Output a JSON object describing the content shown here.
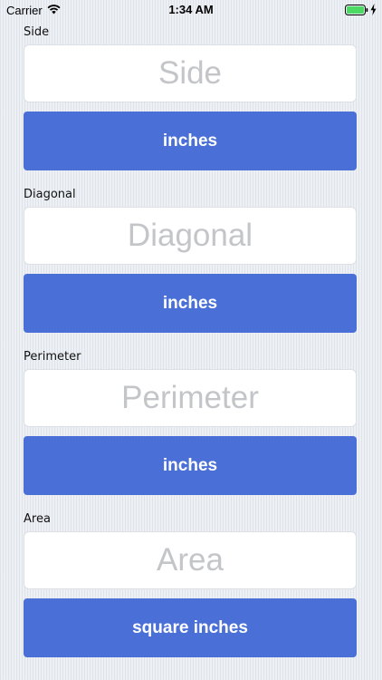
{
  "status_bar": {
    "carrier": "Carrier",
    "time": "1:34 AM",
    "wifi_icon": "wifi-icon",
    "battery_icon": "battery-full-icon",
    "charging_icon": "bolt-icon",
    "battery_color": "#4cd964"
  },
  "fields": [
    {
      "label": "Side",
      "value": "",
      "placeholder": "Side",
      "unit": "inches"
    },
    {
      "label": "Diagonal",
      "value": "",
      "placeholder": "Diagonal",
      "unit": "inches"
    },
    {
      "label": "Perimeter",
      "value": "",
      "placeholder": "Perimeter",
      "unit": "inches"
    },
    {
      "label": "Area",
      "value": "",
      "placeholder": "Area",
      "unit": "square inches"
    }
  ],
  "colors": {
    "button": "#4a6fd6",
    "button_text": "#ffffff",
    "placeholder": "#c4c5c9",
    "background": "#edf0f4"
  }
}
